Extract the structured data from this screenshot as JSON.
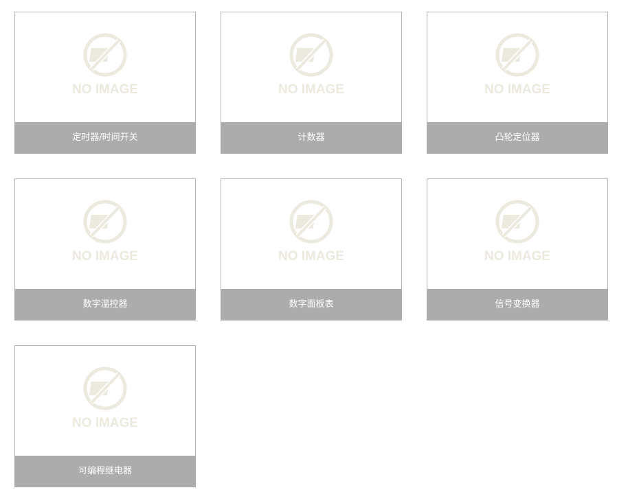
{
  "placeholder": {
    "text": "NO IMAGE",
    "color": "#ece9de"
  },
  "colors": {
    "caption_bg": "#acacac",
    "caption_text": "#ffffff",
    "card_border": "#b4b4b4"
  },
  "products": [
    {
      "label": "定时器/时间开关"
    },
    {
      "label": "计数器"
    },
    {
      "label": "凸轮定位器"
    },
    {
      "label": "数字温控器"
    },
    {
      "label": "数字面板表"
    },
    {
      "label": "信号变换器"
    },
    {
      "label": "可编程继电器"
    }
  ]
}
